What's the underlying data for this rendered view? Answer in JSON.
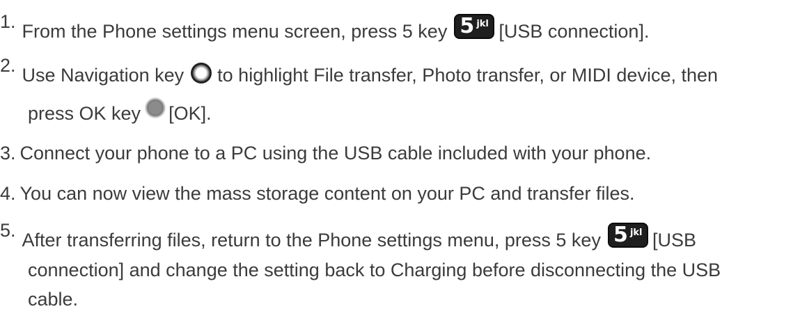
{
  "steps": [
    {
      "number": "1.",
      "text_before": "From the Phone settings menu screen, press 5 key",
      "text_after": "[USB connection]."
    },
    {
      "number": "2.",
      "line1_before": "Use Navigation key",
      "line1_after": "to highlight File transfer, Photo transfer, or MIDI device, then",
      "line2_before": "press OK key",
      "line2_after": "[OK]."
    },
    {
      "number": "3.",
      "text": "Connect your phone to a PC using the USB cable included with your phone."
    },
    {
      "number": "4.",
      "text": "You can now view the mass storage content on your PC and transfer files."
    },
    {
      "number": "5.",
      "line1_before": "After transferring files, return to the Phone settings menu, press 5 key",
      "line1_after": "[USB",
      "line2": "connection] and change the setting back to Charging before disconnecting the USB",
      "line3": "cable."
    }
  ],
  "icons": {
    "key5_digit": "5",
    "key5_letters": "jkl",
    "key5_name": "key-5-icon",
    "nav_key_name": "navigation-key-icon",
    "ok_key_name": "ok-key-icon"
  }
}
